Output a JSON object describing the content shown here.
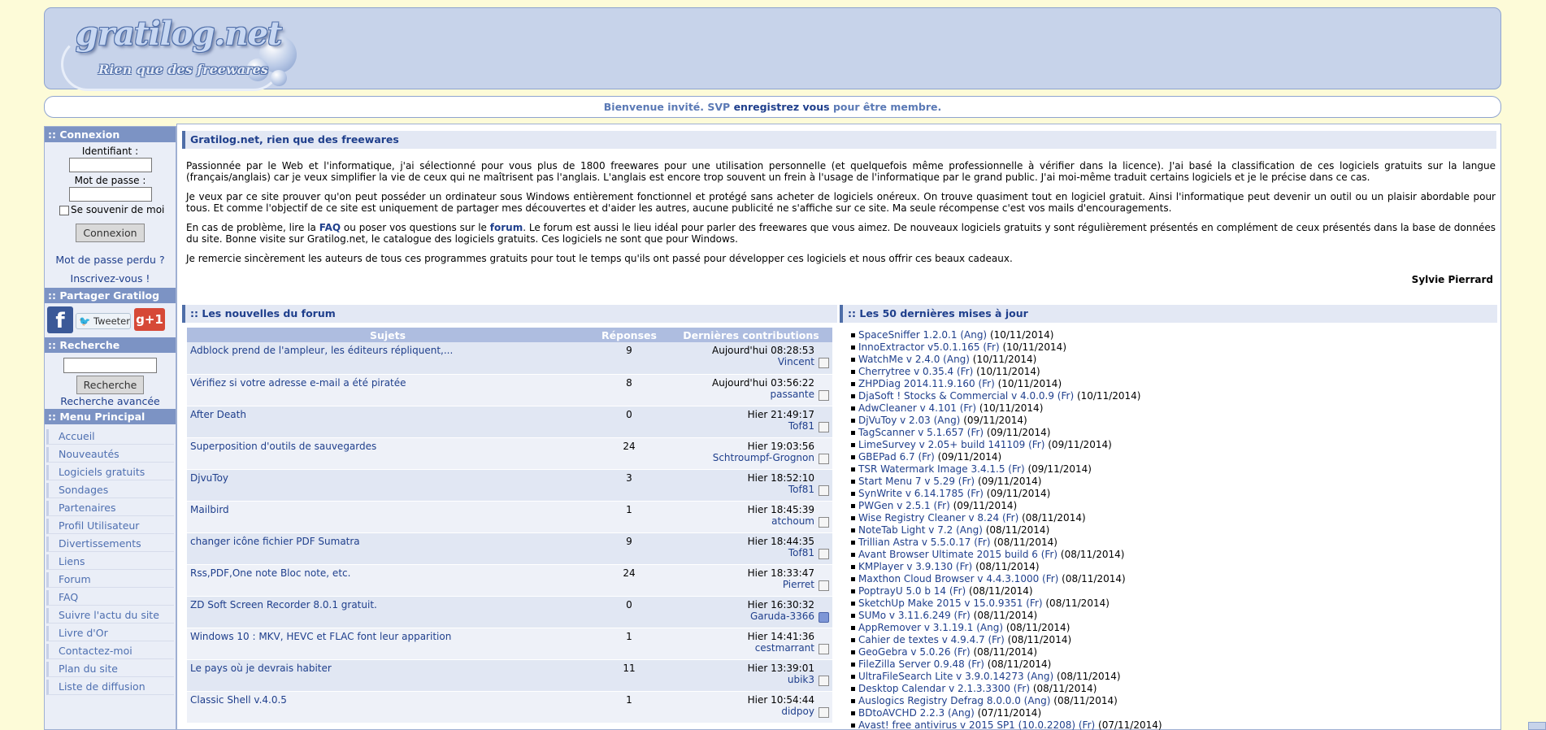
{
  "header": {
    "logo_text": "gratilog.net",
    "logo_tagline": "Rien que des freewares"
  },
  "welcome": {
    "prefix": "Bienvenue invité. SVP ",
    "link": "enregistrez vous",
    "suffix": " pour être membre."
  },
  "sidebar": {
    "login": {
      "title": ":: Connexion",
      "user_label": "Identifiant :",
      "pass_label": "Mot de passe :",
      "remember_label": "Se souvenir de moi",
      "button": "Connexion",
      "lost_password": "Mot de passe perdu ?",
      "register": "Inscrivez-vous !"
    },
    "share": {
      "title": ":: Partager Gratilog",
      "facebook": "f",
      "tweet": "Tweeter",
      "gplus": "g+1"
    },
    "search": {
      "title": ":: Recherche",
      "button": "Recherche",
      "advanced": "Recherche avancée"
    },
    "menu": {
      "title": ":: Menu Principal",
      "items": [
        "Accueil",
        "Nouveautés",
        "Logiciels gratuits",
        "Sondages",
        "Partenaires",
        "Profil Utilisateur",
        "Divertissements",
        "Liens",
        "Forum",
        "FAQ",
        "Suivre l'actu du site",
        "Livre d'Or",
        "Contactez-moi",
        "Plan du site",
        "Liste de diffusion"
      ]
    }
  },
  "intro": {
    "title": "Gratilog.net, rien que des freewares",
    "p1": "Passionnée par le Web et l'informatique, j'ai sélectionné pour vous plus de 1800 freewares pour une utilisation personnelle (et quelquefois même professionnelle à vérifier dans la licence). J'ai basé la classification de ces logiciels gratuits sur la langue (français/anglais) car je veux simplifier la vie de ceux qui ne maîtrisent pas l'anglais. L'anglais est encore trop souvent un frein à l'usage de l'informatique par le grand public. J'ai moi-même traduit certains logiciels et je le précise dans ce cas.",
    "p2": "Je veux par ce site prouver qu'on peut posséder un ordinateur sous Windows entièrement fonctionnel et protégé sans acheter de logiciels onéreux. On trouve quasiment tout en logiciel gratuit. Ainsi l'informatique peut devenir un outil ou un plaisir abordable pour tous. Et comme l'objectif de ce site est uniquement de partager mes découvertes et d'aider les autres, aucune publicité ne s'affiche sur ce site. Ma seule récompense c'est vos mails d'encouragements.",
    "p3_a": "En cas de problème, lire la ",
    "p3_faq": "FAQ",
    "p3_b": " ou poser vos questions sur le ",
    "p3_forum": "forum",
    "p3_c": ". Le forum est aussi le lieu idéal pour parler des freewares que vous aimez. De nouveaux logiciels gratuits y sont régulièrement présentés en complément de ceux présentés dans la base de données du site. Bonne visite sur Gratilog.net, le catalogue des logiciels gratuits. Ces logiciels ne sont que pour Windows.",
    "p4": "Je remercie sincèrement les auteurs de tous ces programmes gratuits pour tout le temps qu'ils ont passé pour développer ces logiciels et nous offrir ces beaux cadeaux.",
    "signature": "Sylvie Pierrard"
  },
  "forum": {
    "title": ":: Les nouvelles du forum",
    "col_subject": "Sujets",
    "col_replies": "Réponses",
    "col_last": "Dernières contributions",
    "rows": [
      {
        "subject": "Adblock prend de l'ampleur, les éditeurs répliquent,...",
        "replies": "9",
        "when": "Aujourd'hui 08:28:53",
        "who": "Vincent"
      },
      {
        "subject": "Vérifiez si votre adresse e-mail a été piratée",
        "replies": "8",
        "when": "Aujourd'hui 03:56:22",
        "who": "passante"
      },
      {
        "subject": "After Death",
        "replies": "0",
        "when": "Hier 21:49:17",
        "who": "Tof81"
      },
      {
        "subject": "Superposition d'outils de sauvegardes",
        "replies": "24",
        "when": "Hier 19:03:56",
        "who": "Schtroumpf-Grognon"
      },
      {
        "subject": "DjvuToy",
        "replies": "3",
        "when": "Hier 18:52:10",
        "who": "Tof81"
      },
      {
        "subject": "Mailbird",
        "replies": "1",
        "when": "Hier 18:45:39",
        "who": "atchoum"
      },
      {
        "subject": "changer icône fichier PDF Sumatra",
        "replies": "9",
        "when": "Hier 18:44:35",
        "who": "Tof81"
      },
      {
        "subject": "Rss,PDF,One note Bloc note, etc.",
        "replies": "24",
        "when": "Hier 18:33:47",
        "who": "Pierret"
      },
      {
        "subject": "ZD Soft Screen Recorder 8.0.1 gratuit.",
        "replies": "0",
        "when": "Hier 16:30:32",
        "who": "Garuda-3366"
      },
      {
        "subject": "Windows 10 : MKV, HEVC et FLAC font leur apparition",
        "replies": "1",
        "when": "Hier 14:41:36",
        "who": "cestmarrant"
      },
      {
        "subject": "Le pays où je devrais habiter",
        "replies": "11",
        "when": "Hier 13:39:01",
        "who": "ubik3"
      },
      {
        "subject": "Classic Shell v.4.0.5",
        "replies": "1",
        "when": "Hier 10:54:44",
        "who": "didpoy"
      }
    ]
  },
  "updates": {
    "title": ":: Les 50 dernières mises à jour",
    "items": [
      {
        "name": "SpaceSniffer 1.2.0.1 (Ang)",
        "date": " (10/11/2014)"
      },
      {
        "name": "InnoExtractor v5.0.1.165 (Fr)",
        "date": " (10/11/2014)"
      },
      {
        "name": "WatchMe v 2.4.0 (Ang)",
        "date": " (10/11/2014)"
      },
      {
        "name": "Cherrytree v 0.35.4 (Fr)",
        "date": " (10/11/2014)"
      },
      {
        "name": "ZHPDiag 2014.11.9.160 (Fr)",
        "date": " (10/11/2014)"
      },
      {
        "name": "DjaSoft ! Stocks & Commercial v 4.0.0.9 (Fr)",
        "date": " (10/11/2014)"
      },
      {
        "name": "AdwCleaner v 4.101 (Fr)",
        "date": " (10/11/2014)"
      },
      {
        "name": "DjVuToy v 2.03 (Ang)",
        "date": " (09/11/2014)"
      },
      {
        "name": "TagScanner v 5.1.657 (Fr)",
        "date": " (09/11/2014)"
      },
      {
        "name": "LimeSurvey v 2.05+ build 141109 (Fr)",
        "date": " (09/11/2014)"
      },
      {
        "name": "GBEPad 6.7 (Fr)",
        "date": " (09/11/2014)"
      },
      {
        "name": "TSR Watermark Image 3.4.1.5 (Fr)",
        "date": " (09/11/2014)"
      },
      {
        "name": "Start Menu 7 v 5.29 (Fr)",
        "date": " (09/11/2014)"
      },
      {
        "name": "SynWrite v 6.14.1785 (Fr)",
        "date": " (09/11/2014)"
      },
      {
        "name": "PWGen v 2.5.1 (Fr)",
        "date": " (09/11/2014)"
      },
      {
        "name": "Wise Registry Cleaner v 8.24 (Fr)",
        "date": " (08/11/2014)"
      },
      {
        "name": "NoteTab Light v 7.2 (Ang)",
        "date": " (08/11/2014)"
      },
      {
        "name": "Trillian Astra v 5.5.0.17 (Fr)",
        "date": " (08/11/2014)"
      },
      {
        "name": "Avant Browser Ultimate 2015 build 6 (Fr)",
        "date": " (08/11/2014)"
      },
      {
        "name": "KMPlayer v 3.9.130 (Fr)",
        "date": " (08/11/2014)"
      },
      {
        "name": "Maxthon Cloud Browser v 4.4.3.1000 (Fr)",
        "date": " (08/11/2014)"
      },
      {
        "name": "PoptrayU 5.0 b 14 (Fr)",
        "date": " (08/11/2014)"
      },
      {
        "name": "SketchUp Make 2015 v 15.0.9351 (Fr)",
        "date": " (08/11/2014)"
      },
      {
        "name": "SUMo v 3.11.6.249 (Fr)",
        "date": " (08/11/2014)"
      },
      {
        "name": "AppRemover v 3.1.19.1 (Ang)",
        "date": " (08/11/2014)"
      },
      {
        "name": "Cahier de textes v 4.9.4.7 (Fr)",
        "date": " (08/11/2014)"
      },
      {
        "name": "GeoGebra v 5.0.26 (Fr)",
        "date": " (08/11/2014)"
      },
      {
        "name": "FileZilla Server 0.9.48 (Fr)",
        "date": " (08/11/2014)"
      },
      {
        "name": "UltraFileSearch Lite v 3.9.0.14273 (Ang)",
        "date": " (08/11/2014)"
      },
      {
        "name": "Desktop Calendar v 2.1.3.3300 (Fr)",
        "date": " (08/11/2014)"
      },
      {
        "name": "Auslogics Registry Defrag 8.0.0.0 (Ang)",
        "date": " (08/11/2014)"
      },
      {
        "name": "BDtoAVCHD 2.2.3 (Ang)",
        "date": " (07/11/2014)"
      },
      {
        "name": "Avast! free antivirus v 2015 SP1 (10.0.2208) (Fr)",
        "date": " (07/11/2014)"
      }
    ]
  }
}
